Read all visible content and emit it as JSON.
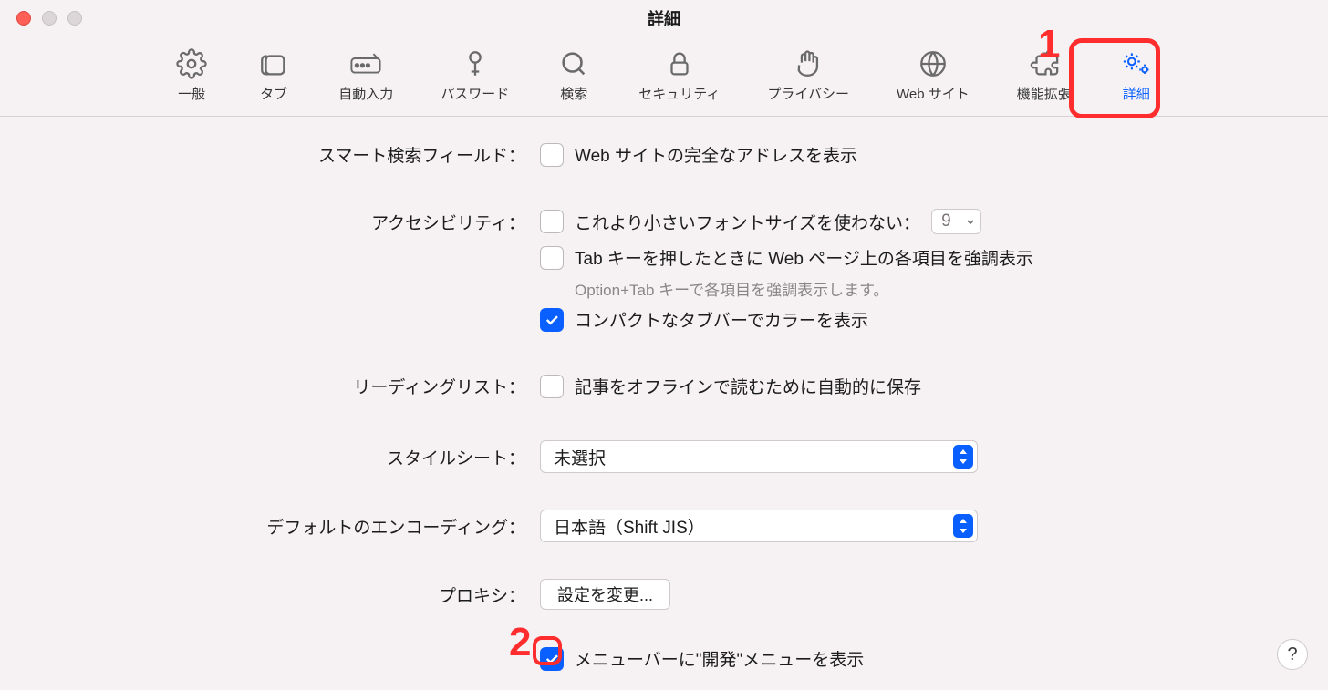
{
  "window": {
    "title": "詳細"
  },
  "toolbar": {
    "tabs": [
      {
        "label": "一般"
      },
      {
        "label": "タブ"
      },
      {
        "label": "自動入力"
      },
      {
        "label": "パスワード"
      },
      {
        "label": "検索"
      },
      {
        "label": "セキュリティ"
      },
      {
        "label": "プライバシー"
      },
      {
        "label": "Web サイト"
      },
      {
        "label": "機能拡張"
      },
      {
        "label": "詳細"
      }
    ]
  },
  "settings": {
    "smart_search": {
      "label": "スマート検索フィールド：",
      "opt1": "Web サイトの完全なアドレスを表示"
    },
    "accessibility": {
      "label": "アクセシビリティ：",
      "opt1": "これより小さいフォントサイズを使わない：",
      "font_size": "9",
      "opt2": "Tab キーを押したときに Web ページ上の各項目を強調表示",
      "helper": "Option+Tab キーで各項目を強調表示します。",
      "opt3": "コンパクトなタブバーでカラーを表示"
    },
    "reading_list": {
      "label": "リーディングリスト：",
      "opt1": "記事をオフラインで読むために自動的に保存"
    },
    "stylesheet": {
      "label": "スタイルシート：",
      "value": "未選択"
    },
    "encoding": {
      "label": "デフォルトのエンコーディング：",
      "value": "日本語（Shift JIS）"
    },
    "proxy": {
      "label": "プロキシ：",
      "button": "設定を変更..."
    },
    "develop": {
      "opt1": "メニューバーに\"開発\"メニューを表示"
    }
  },
  "annotations": {
    "n1": "1",
    "n2": "2"
  },
  "help": "?"
}
